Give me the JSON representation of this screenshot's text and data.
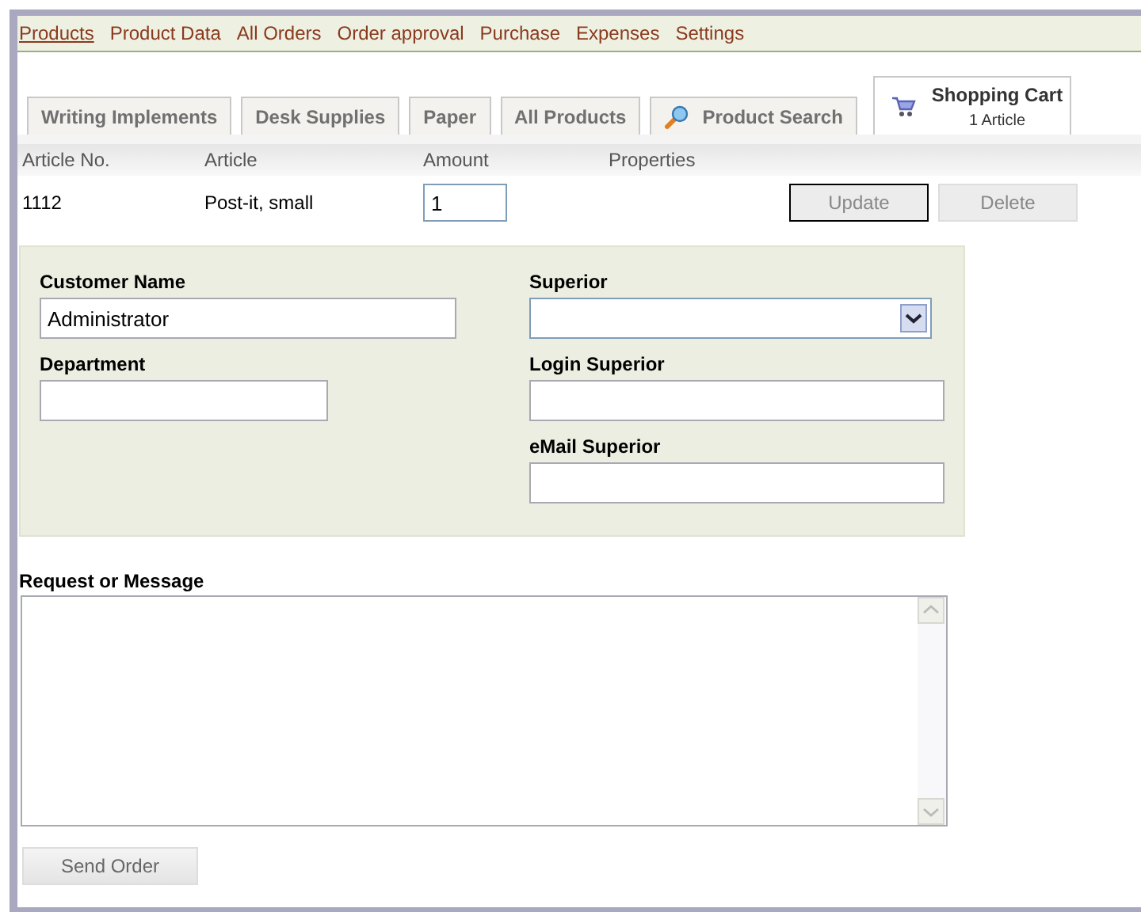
{
  "menu": [
    {
      "label": "Products",
      "selected": true
    },
    {
      "label": "Product Data",
      "selected": false
    },
    {
      "label": "All Orders",
      "selected": false
    },
    {
      "label": "Order approval",
      "selected": false
    },
    {
      "label": "Purchase",
      "selected": false
    },
    {
      "label": "Expenses",
      "selected": false
    },
    {
      "label": "Settings",
      "selected": false
    }
  ],
  "tabs": [
    {
      "label": "Writing Implements",
      "kind": "plain"
    },
    {
      "label": "Desk Supplies",
      "kind": "plain"
    },
    {
      "label": "Paper",
      "kind": "plain"
    },
    {
      "label": "All Products",
      "kind": "plain"
    },
    {
      "label": "Product Search",
      "kind": "search"
    }
  ],
  "cart": {
    "title": "Shopping Cart",
    "count": "1 Article",
    "selected": true
  },
  "table": {
    "columns": [
      "Article No.",
      "Article",
      "Amount",
      "Properties"
    ],
    "rows": [
      {
        "article_no": "1112",
        "article": "Post-it, small",
        "amount": "1"
      }
    ],
    "buttons": [
      {
        "label": "Update",
        "focused": true
      },
      {
        "label": "Delete",
        "focused": false
      }
    ]
  },
  "form": {
    "customer_name": {
      "label": "Customer Name",
      "value": "Administrator"
    },
    "department": {
      "label": "Department"
    },
    "superior": {
      "label": "Superior"
    },
    "login_superior": {
      "label": "Login Superior"
    },
    "email_superior": {
      "label": "eMail Superior"
    }
  },
  "message": {
    "label": "Request or Message"
  },
  "send_button": "Send Order"
}
